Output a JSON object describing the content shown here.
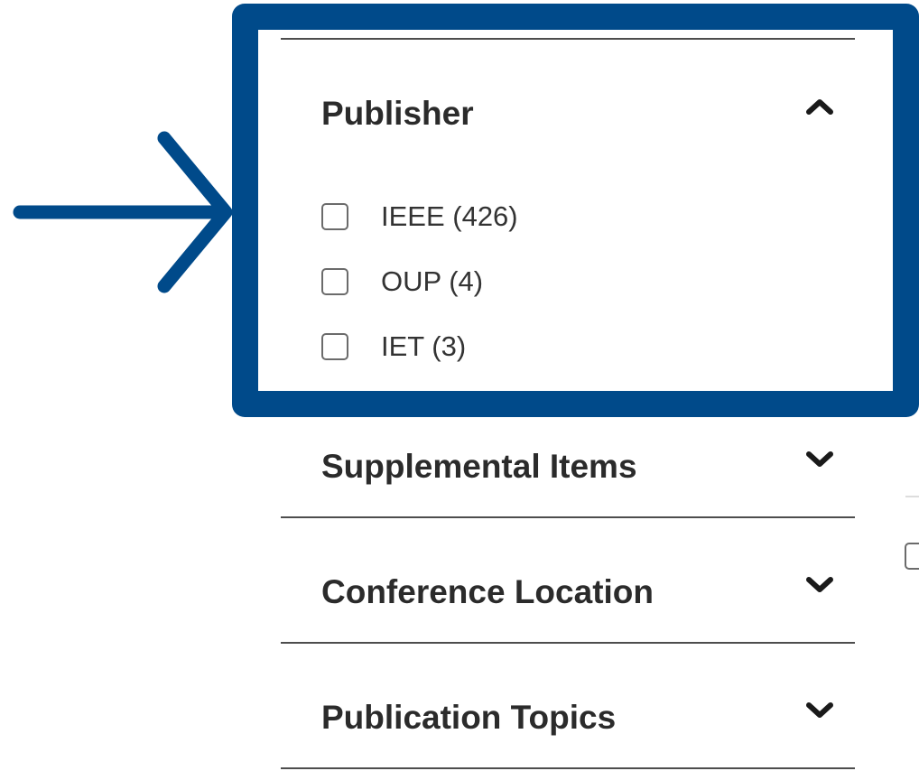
{
  "filters": {
    "publisher": {
      "title": "Publisher",
      "expanded": true,
      "options": [
        {
          "label": "IEEE (426)",
          "checked": false
        },
        {
          "label": "OUP (4)",
          "checked": false
        },
        {
          "label": "IET (3)",
          "checked": false
        }
      ]
    },
    "collapsed_sections": [
      {
        "title": "Supplemental Items",
        "expanded": false
      },
      {
        "title": "Conference Location",
        "expanded": false
      },
      {
        "title": "Publication Topics",
        "expanded": false
      }
    ]
  },
  "icons": {
    "expanded_chevron": "chevron-up-icon",
    "collapsed_chevron": "chevron-down-icon",
    "pointer_arrow": "arrow-right-icon"
  },
  "colors": {
    "highlight": "#004a8a",
    "divider": "#4d4d4d",
    "heading_text": "#2b2b2b"
  }
}
